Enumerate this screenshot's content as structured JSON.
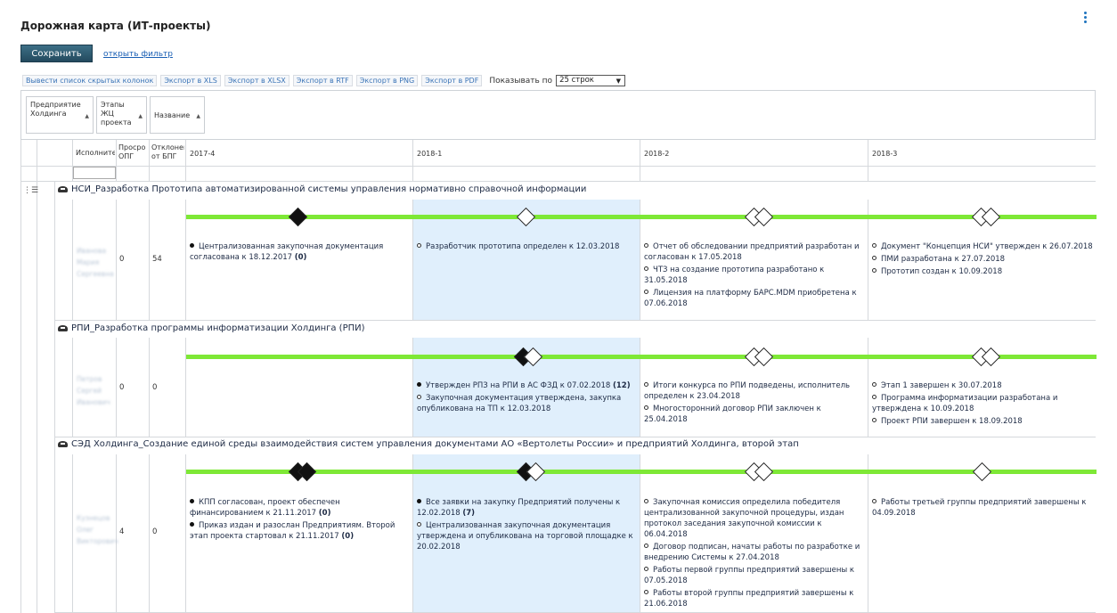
{
  "page": {
    "title": "Дорожная карта (ИТ-проекты)"
  },
  "actions": {
    "save_label": "Сохранить",
    "filter_link": "открыть фильтр"
  },
  "toolbar": {
    "hidden_columns": "Вывести список скрытых колонок",
    "export_xls": "Экспорт в XLS",
    "export_xlsx": "Экспорт в XLSX",
    "export_rtf": "Экспорт в RTF",
    "export_png": "Экспорт в PNG",
    "export_pdf": "Экспорт в PDF",
    "show_label": "Показывать по",
    "page_size": "25 строк"
  },
  "groups": [
    {
      "label": "Предприятие Холдинга"
    },
    {
      "label": "Этапы ЖЦ проекта"
    },
    {
      "label": "Название"
    }
  ],
  "columns": {
    "executor": "Исполнитель",
    "overdue": "Просро ОПГ",
    "deviation": "Отклонение от БПГ",
    "periods": [
      "2017-4",
      "2018-1",
      "2018-2",
      "2018-3"
    ]
  },
  "colors": {
    "bar": "#7ee836",
    "highlight": "#e0effc",
    "link": "#1a5fb4"
  },
  "projects": [
    {
      "title": "НСИ_Разработка Прототипа автоматизированной системы управления нормативно справочной информации",
      "executor": "Иванова Мария Сергеевна",
      "overdue": "0",
      "deviation": "54",
      "milestones": [
        [
          {
            "text": "Централизованная закупочная документация согласована к 18.12.2017",
            "count": "(0)",
            "done": true
          }
        ],
        [
          {
            "text": "Разработчик прототипа определен к 12.03.2018",
            "done": false
          }
        ],
        [
          {
            "text": "Отчет об обследовании предприятий разработан и согласован к 17.05.2018",
            "done": false
          },
          {
            "text": "ЧТЗ на создание прототипа разработано к 31.05.2018",
            "done": false
          },
          {
            "text": "Лицензия на платформу БАРС.MDM приобретена к 07.06.2018",
            "done": false
          }
        ],
        [
          {
            "text": "Документ \"Концепция НСИ\" утвержден к 26.07.2018",
            "done": false
          },
          {
            "text": "ПМИ разработана к 27.07.2018",
            "done": false
          },
          {
            "text": "Прототип создан к 10.09.2018",
            "done": false
          }
        ]
      ]
    },
    {
      "title": "РПИ_Разработка программы информатизации Холдинга (РПИ)",
      "executor": "Петров Сергей Иванович",
      "overdue": "0",
      "deviation": "0",
      "milestones": [
        [],
        [
          {
            "text": "Утвержден РПЗ на РПИ в АС ФЗД к 07.02.2018",
            "count": "(12)",
            "done": true
          },
          {
            "text": "Закупочная документация утверждена, закупка опубликована на ТП к 12.03.2018",
            "done": false
          }
        ],
        [
          {
            "text": "Итоги конкурса по РПИ подведены, исполнитель определен к 23.04.2018",
            "done": false
          },
          {
            "text": "Многосторонний договор РПИ заключен к 25.04.2018",
            "done": false
          }
        ],
        [
          {
            "text": "Этап 1 завершен к 30.07.2018",
            "done": false
          },
          {
            "text": "Программа информатизации разработана и утверждена к 10.09.2018",
            "done": false
          },
          {
            "text": "Проект РПИ завершен к 18.09.2018",
            "done": false
          }
        ]
      ]
    },
    {
      "title": "СЭД Холдинга_Создание единой среды взаимодействия систем управления документами АО «Вертолеты России» и предприятий Холдинга, второй этап",
      "executor": "Кузнецов Олег Викторович",
      "overdue": "4",
      "deviation": "0",
      "milestones": [
        [
          {
            "text": "КПП согласован, проект обеспечен финансированием к 21.11.2017",
            "count": "(0)",
            "done": true
          },
          {
            "text": "Приказ издан и разослан Предприятиям. Второй этап проекта стартовал к 21.11.2017",
            "count": "(0)",
            "done": true
          }
        ],
        [
          {
            "text": "Все заявки на закупку Предприятий получены к 12.02.2018",
            "count": "(7)",
            "done": true
          },
          {
            "text": "Централизованная закупочная документация утверждена и опубликована на торговой площадке к 20.02.2018",
            "done": false
          }
        ],
        [
          {
            "text": "Закупочная комиссия определила победителя централизованной закупочной процедуры, издан протокол заседания закупочной комиссии к 06.04.2018",
            "done": false
          },
          {
            "text": "Договор подписан, начаты работы по разработке и внедрению Системы к 27.04.2018",
            "done": false
          },
          {
            "text": "Работы первой группы предприятий завершены к 07.05.2018",
            "done": false
          },
          {
            "text": "Работы второй группы предприятий завершены к 21.06.2018",
            "done": false
          }
        ],
        [
          {
            "text": "Работы третьей группы предприятий завершены к 04.09.2018",
            "done": false
          }
        ]
      ]
    }
  ]
}
